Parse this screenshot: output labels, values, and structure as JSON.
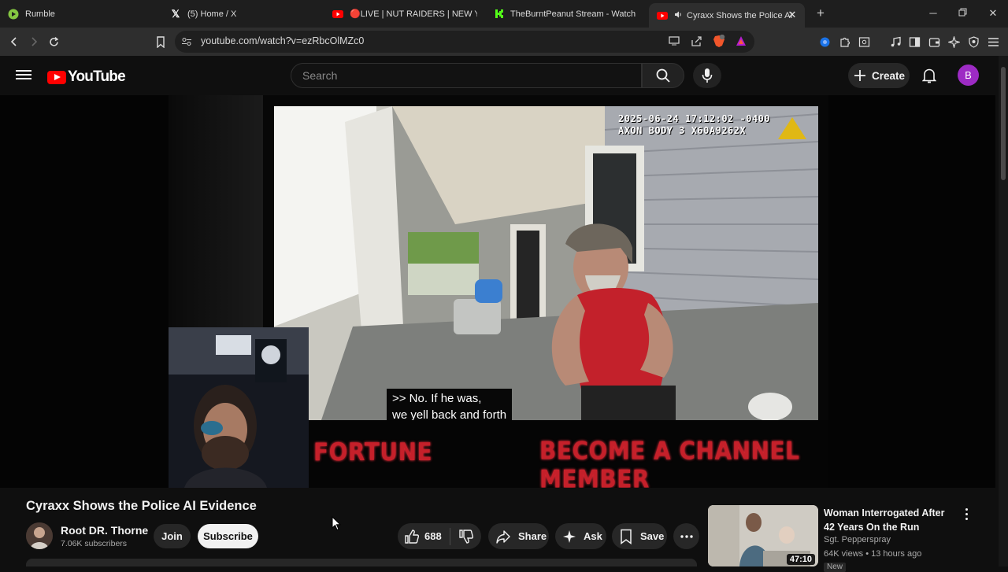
{
  "browser": {
    "tabs": [
      {
        "label": "Rumble",
        "icon": "rumble-icon"
      },
      {
        "label": "(5) Home / X",
        "icon": "x-icon"
      },
      {
        "label": "🔴LIVE | NUT RAIDERS | NEW YEAR N",
        "icon": "youtube-icon"
      },
      {
        "label": "TheBurntPeanut Stream - Watch Live",
        "icon": "kick-icon"
      },
      {
        "label": "Cyraxx Shows the Police AI Ev",
        "icon": "youtube-icon",
        "active": true
      }
    ],
    "url": "youtube.com/watch?v=ezRbcOlMZc0"
  },
  "youtube": {
    "logo_text": "YouTube",
    "search_placeholder": "Search",
    "create_label": "Create",
    "avatar_letter": "B",
    "accent": "#ff0000"
  },
  "video": {
    "osd_line1": "2025-06-24 17:12:02 -0400",
    "osd_line2": "AXON BODY 3 X60A9262X",
    "caption_line1": ">> No. If he was,",
    "caption_line2": "we yell back and forth",
    "banner_left": "FORTUNE",
    "banner_right": "BECOME A CHANNEL MEMBER",
    "title": "Cyraxx Shows the Police AI Evidence"
  },
  "channel": {
    "name": "Root DR. Thorne",
    "subscribers": "7.06K subscribers",
    "join_label": "Join",
    "subscribe_label": "Subscribe"
  },
  "actions": {
    "like_count": "688",
    "share_label": "Share",
    "ask_label": "Ask",
    "save_label": "Save"
  },
  "recommendation": {
    "title": "Woman Interrogated After 42 Years On the Run",
    "channel": "Sgt. Pepperspray",
    "meta": "64K views • 13 hours ago",
    "duration": "47:10",
    "badge": "New"
  }
}
